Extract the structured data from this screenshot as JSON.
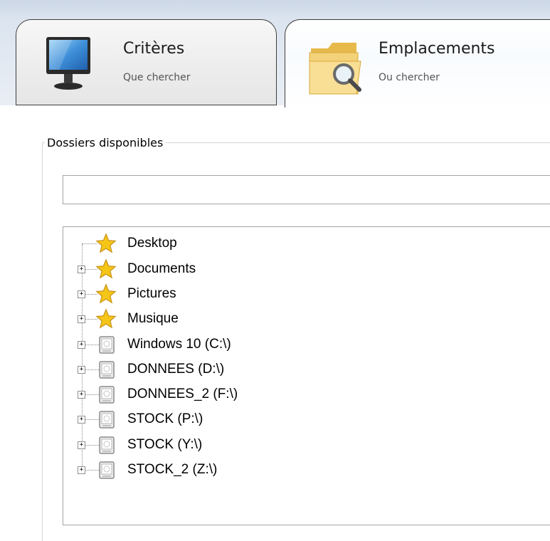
{
  "tabs": [
    {
      "title": "Critères",
      "subtitle": "Que chercher",
      "icon": "monitor-icon"
    },
    {
      "title": "Emplacements",
      "subtitle": "Ou chercher",
      "icon": "folder-search-icon"
    }
  ],
  "group": {
    "legend": "Dossiers disponibles"
  },
  "path_input": {
    "value": "",
    "placeholder": ""
  },
  "tree": [
    {
      "label": "Desktop",
      "icon": "star-icon",
      "expandable": false
    },
    {
      "label": "Documents",
      "icon": "star-icon",
      "expandable": true
    },
    {
      "label": "Pictures",
      "icon": "star-icon",
      "expandable": true
    },
    {
      "label": "Musique",
      "icon": "star-icon",
      "expandable": true
    },
    {
      "label": "Windows 10 (C:\\)",
      "icon": "drive-icon",
      "expandable": true
    },
    {
      "label": "DONNEES (D:\\)",
      "icon": "drive-icon",
      "expandable": true
    },
    {
      "label": "DONNEES_2 (F:\\)",
      "icon": "drive-icon",
      "expandable": true
    },
    {
      "label": "STOCK (P:\\)",
      "icon": "drive-icon",
      "expandable": true
    },
    {
      "label": "STOCK (Y:\\)",
      "icon": "drive-icon",
      "expandable": true
    },
    {
      "label": "STOCK_2 (Z:\\)",
      "icon": "drive-icon",
      "expandable": true
    }
  ],
  "colors": {
    "background_band": "#dbe4ef",
    "tab_border": "#3c3c3c",
    "star": "#f5c518",
    "folder": "#f2c94c"
  }
}
